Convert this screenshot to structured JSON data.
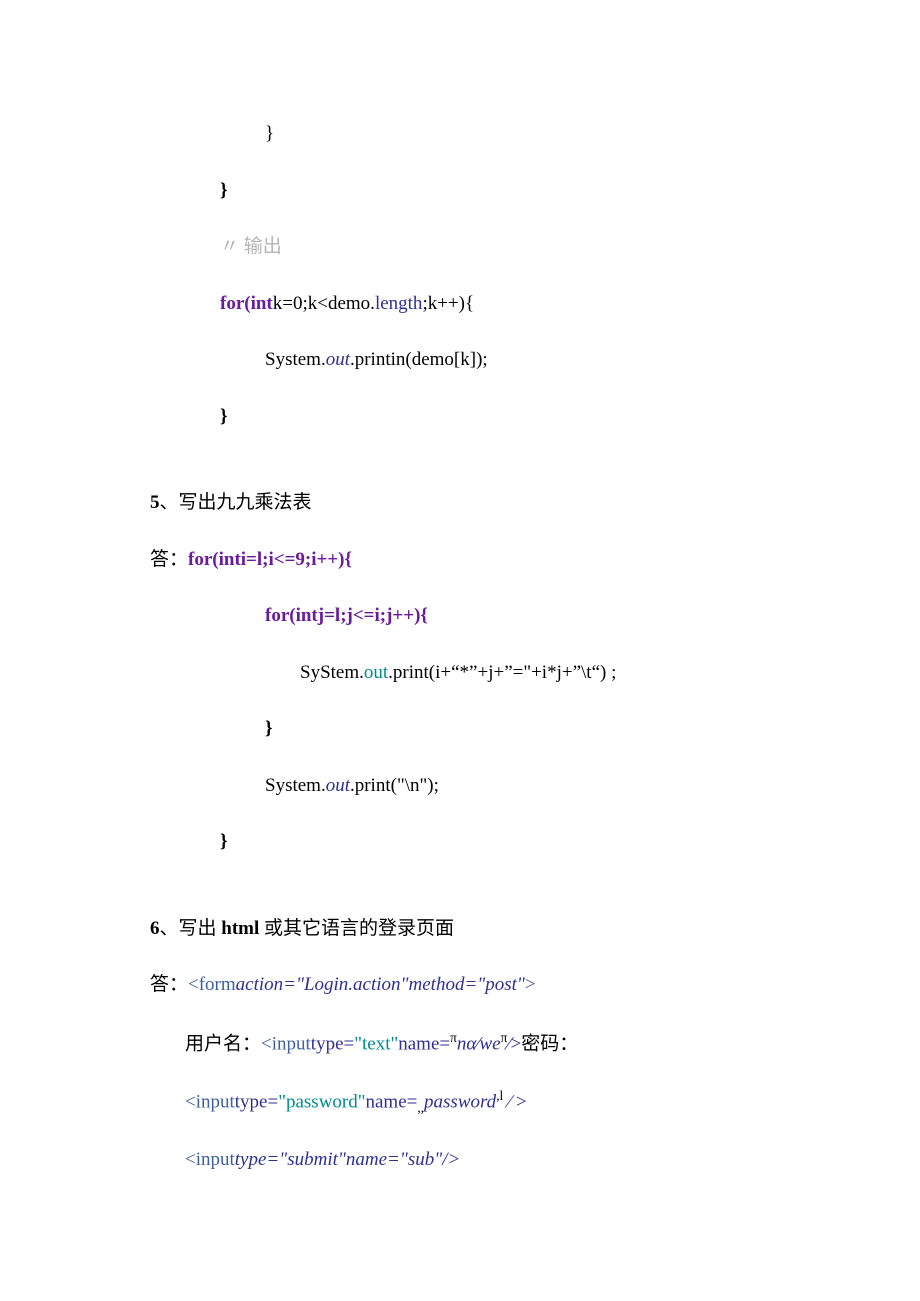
{
  "lines": {
    "l1": "}",
    "l2": "}",
    "l3a": "〃",
    "l3b": "输出",
    "l4a": "for(int",
    "l4b": "k=0;k<demo.",
    "l4c": "length",
    "l4d": ";k++){",
    "l5a": "System.",
    "l5b": "out",
    "l5c": ".printin(demo[k]);",
    "l6": "}",
    "q5num": "5",
    "q5punct": "、",
    "q5text": "写出九九乘法表",
    "a5a": "答：",
    "a5b": "for(inti=l;i<=9;i++){",
    "l7": "for(intj=l;j<=i;j++){",
    "l8a": "SyStem.",
    "l8b": "out",
    "l8c": ".print(i+“*”+j+”=\"+i*j+”\\t“) ;",
    "l9": "}",
    "l10a": "System.",
    "l10b": "out",
    "l10c": ".print(\"\\n\");",
    "l11": "}",
    "q6num": "6",
    "q6punct": "、",
    "q6a": "写出 ",
    "q6b": "html ",
    "q6c": "或其它语言的登录页面",
    "a6a": "答：",
    "a6b": "<form",
    "a6c": "action=\"Login.action\"method=\"post\"",
    "a6d": ">",
    "l12a": "用户名：",
    "l12b": "<input",
    "l12c": "type=",
    "l12d": "\"text\"",
    "l12e": "name=",
    "l12f": "π",
    "l12g": "nα⁄we",
    "l12h": "π",
    "l12i": "∕>",
    "l12j": "密码：",
    "l13a": "<input",
    "l13b": "type=",
    "l13c": "\"password\"",
    "l13d": "name=",
    "l13e": ",,",
    "l13f": "password",
    "l13g": ",l",
    "l13h": " ∕ >",
    "l14a": "<input",
    "l14b": "type=\"submit\"name=\"sub\"/>"
  }
}
